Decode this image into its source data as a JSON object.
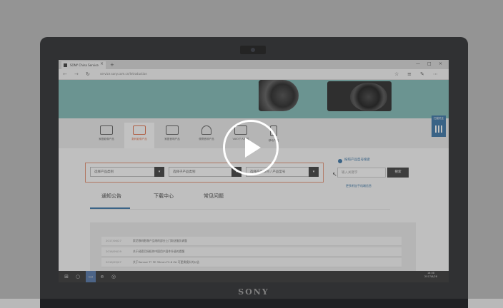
{
  "browser": {
    "tab_title": "SONY China Service",
    "tab_close": "×",
    "new_tab": "+",
    "window_controls": [
      "—",
      "□",
      "×"
    ],
    "nav_icons": [
      "←",
      "→",
      "↻"
    ],
    "url": "service.sony.com.cn/Introduction",
    "right_icons": [
      "☆",
      "≡",
      "✎",
      "⋯"
    ]
  },
  "categories": [
    {
      "label": "家庭影像产品"
    },
    {
      "label": "数码影像产品",
      "active": true
    },
    {
      "label": "家庭音响产品"
    },
    {
      "label": "便携音响产品"
    },
    {
      "label": "VAIO个人电脑"
    },
    {
      "label": "移动产品"
    }
  ],
  "side_button": {
    "label": "扫描关注"
  },
  "selectors": [
    {
      "placeholder": "选择产品类别"
    },
    {
      "placeholder": "选择子产品类别"
    },
    {
      "placeholder": "选择产品系列 / 产品型号"
    }
  ],
  "dropdown_glyph": "▾",
  "model_search": {
    "label": "按照产品型号搜索",
    "placeholder": "输入关键字",
    "button": "搜索",
    "link": "更多附加手机端信息"
  },
  "notice_tabs": [
    "通知公告",
    "下载中心",
    "常见问题"
  ],
  "notices": [
    {
      "date": "2017/06/27",
      "text": "索尼数码影像产品线的部分上门取送服务调整"
    },
    {
      "date": "2016/09/19",
      "text": "关于经索尼授权的中国用户固件升级的提醒"
    },
    {
      "date": "2016/09/07",
      "text": "关于Sonnar T* FE 35mm F2.8 ZA 可更换镜头的公告"
    }
  ],
  "taskbar": {
    "icons": [
      "⊞",
      "○",
      "▭",
      "e",
      "◎"
    ],
    "time": "18:08",
    "date": "2017/6/28"
  },
  "brand": "SONY",
  "colors": {
    "accent": "#2f6ea3",
    "active_category": "#e2673f",
    "hero": "#7ab8b4"
  }
}
